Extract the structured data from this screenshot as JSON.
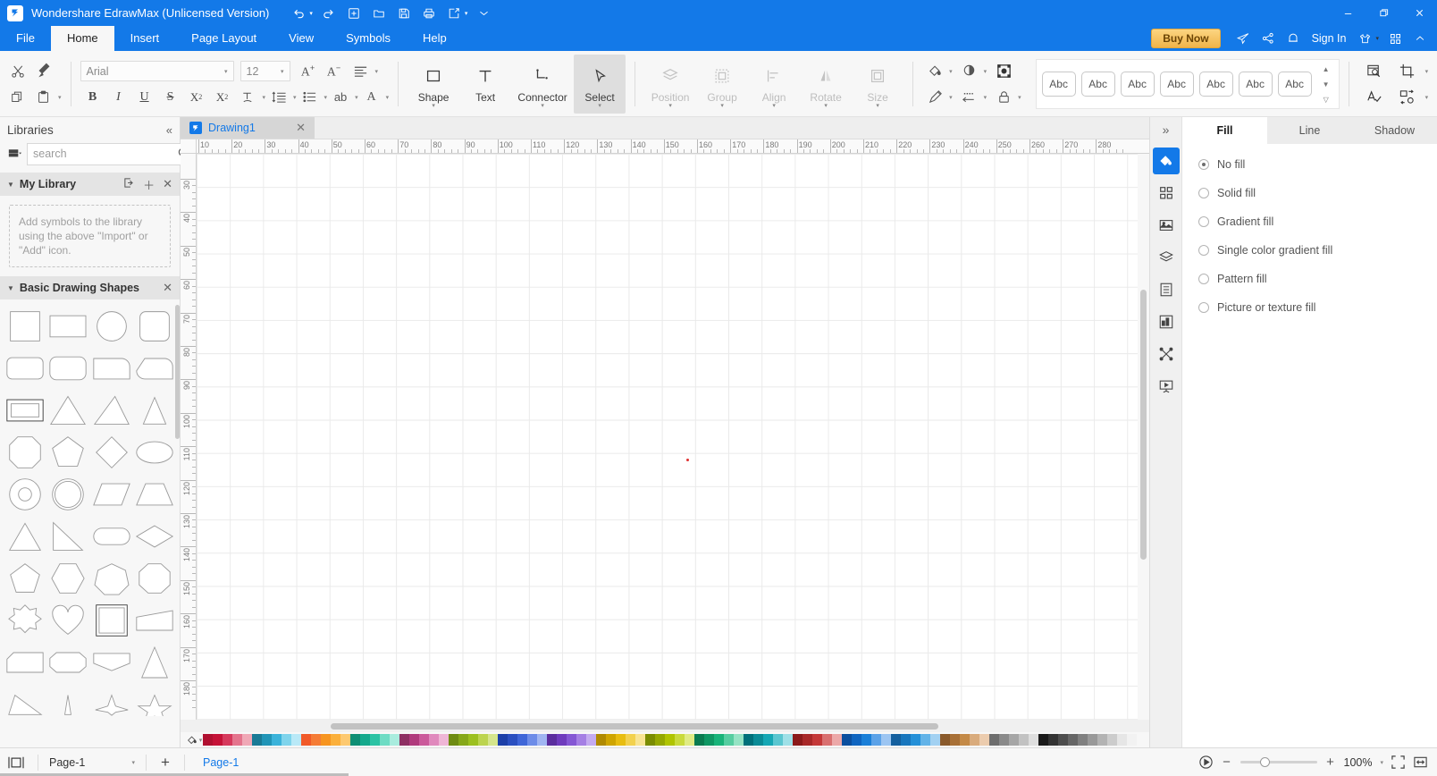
{
  "window": {
    "app_title": "Wondershare EdrawMax (Unlicensed Version)",
    "logo_glyph": "Ɔ",
    "quick_access": [
      {
        "name": "undo-button",
        "glyph": "↺",
        "caret": true
      },
      {
        "name": "redo-button",
        "glyph": "↻",
        "caret": false
      },
      {
        "name": "new-document-button",
        "glyph": "⊞",
        "caret": false
      },
      {
        "name": "open-file-button",
        "glyph": "🗀",
        "caret": false
      },
      {
        "name": "save-button",
        "glyph": "🖫",
        "caret": false
      },
      {
        "name": "print-button",
        "glyph": "🖶",
        "caret": false
      },
      {
        "name": "export-share-button",
        "glyph": "↗",
        "caret": true
      }
    ],
    "more_qat_glyph": "⌄",
    "minimize_label": "—",
    "maximize_label": "❐",
    "close_label": "✕"
  },
  "menubar": {
    "items": [
      {
        "label": "File",
        "active": false
      },
      {
        "label": "Home",
        "active": true
      },
      {
        "label": "Insert",
        "active": false
      },
      {
        "label": "Page Layout",
        "active": false
      },
      {
        "label": "View",
        "active": false
      },
      {
        "label": "Symbols",
        "active": false
      },
      {
        "label": "Help",
        "active": false
      }
    ],
    "buy_now_label": "Buy Now",
    "sign_in_label": "Sign In",
    "right_icons": [
      {
        "name": "send-feedback-icon",
        "glyph": "➤"
      },
      {
        "name": "share-icon",
        "glyph": "⤳"
      },
      {
        "name": "notifications-bell-icon",
        "glyph": "🔔"
      },
      {
        "name": "theme-shirt-icon",
        "glyph": "👕"
      },
      {
        "name": "apps-grid-icon",
        "glyph": "⠿"
      },
      {
        "name": "collapse-ribbon-icon",
        "glyph": "⌃"
      }
    ]
  },
  "ribbon": {
    "clipboard": [
      {
        "name": "cut-button",
        "glyph": "✂",
        "caret": false
      },
      {
        "name": "format-painter-button",
        "glyph": "🖌",
        "caret": false
      },
      {
        "name": "copy-button",
        "glyph": "⧉",
        "caret": false
      },
      {
        "name": "paste-button",
        "glyph": "📋",
        "caret": true
      }
    ],
    "font": {
      "family_value": "Arial",
      "size_value": "12",
      "increase_size_label": "A",
      "decrease_size_label": "A",
      "align_icon": "☰",
      "bold_label": "B",
      "italic_label": "I",
      "underline_label": "U",
      "strikethrough_label": "S",
      "superscript_label": "X²",
      "subscript_label": "X₂",
      "text_color_label": "T",
      "line_spacing_label": "↕☰",
      "bullets_label": "☰",
      "wrap_text_label": "ab",
      "font_style_label": "A"
    },
    "tools": [
      {
        "name": "shape-tool",
        "label": "Shape",
        "icon": "square",
        "enabled": true,
        "active": false,
        "caret": true
      },
      {
        "name": "text-tool",
        "label": "Text",
        "icon": "text",
        "enabled": true,
        "active": false,
        "caret": false
      },
      {
        "name": "connector-tool",
        "label": "Connector",
        "icon": "connector",
        "enabled": true,
        "active": false,
        "caret": true
      },
      {
        "name": "select-tool",
        "label": "Select",
        "icon": "cursor",
        "enabled": true,
        "active": true,
        "caret": true
      }
    ],
    "arrange": [
      {
        "name": "position-tool",
        "label": "Position",
        "icon": "layers",
        "enabled": false,
        "caret": true
      },
      {
        "name": "group-tool",
        "label": "Group",
        "icon": "group",
        "enabled": false,
        "caret": true
      },
      {
        "name": "align-tool",
        "label": "Align",
        "icon": "align",
        "enabled": false,
        "caret": true
      },
      {
        "name": "rotate-tool",
        "label": "Rotate",
        "icon": "rotate",
        "enabled": false,
        "caret": true
      },
      {
        "name": "size-tool",
        "label": "Size",
        "icon": "size",
        "enabled": false,
        "caret": true
      }
    ],
    "style_icons": [
      {
        "name": "fill-color-button",
        "glyph": "fill",
        "caret": true
      },
      {
        "name": "shadow-button",
        "glyph": "shadow",
        "caret": true
      },
      {
        "name": "select-all-button",
        "glyph": "selectall",
        "caret": false
      },
      {
        "name": "line-color-button",
        "glyph": "pen",
        "caret": true
      },
      {
        "name": "line-style-button",
        "glyph": "dash-arrow",
        "caret": true
      },
      {
        "name": "lock-button",
        "glyph": "lock",
        "caret": true
      }
    ],
    "quick_styles_label": "Abc",
    "quick_styles_count": 7,
    "right_tools": [
      {
        "name": "find-replace-button",
        "glyph": "find",
        "caret": false
      },
      {
        "name": "crop-button",
        "glyph": "crop",
        "caret": true
      },
      {
        "name": "spell-check-button",
        "glyph": "spell",
        "caret": false
      },
      {
        "name": "replace-shape-button",
        "glyph": "replace",
        "caret": true
      }
    ]
  },
  "libraries": {
    "title": "Libraries",
    "collapse_glyph": "«",
    "search_placeholder": "search",
    "search_value": "",
    "library_menu_glyph": "🗄",
    "nav_up_glyph": "⌃",
    "nav_down_glyph": "⌄",
    "sections": [
      {
        "name": "My Library",
        "expanded": true,
        "actions": [
          "import-icon",
          "add-icon",
          "close-icon"
        ],
        "empty_text": "Add symbols to the library using the above \"Import\" or \"Add\" icon."
      },
      {
        "name": "Basic Drawing Shapes",
        "expanded": true,
        "actions": [
          "close-icon"
        ]
      }
    ],
    "shapes": [
      "square",
      "rectangle",
      "circle",
      "rounded-square",
      "rounded-rectangle-small",
      "rounded-rectangle",
      "one-corner-rounded-rect",
      "two-corner-rounded-rect",
      "double-rectangle",
      "triangle-isosceles",
      "triangle-right-lean",
      "triangle-narrow",
      "octagon-cut-square",
      "pentagon",
      "diamond",
      "ellipse",
      "donut",
      "concentric-circle",
      "parallelogram",
      "trapezoid",
      "triangle-equilateral",
      "right-triangle",
      "stadium",
      "rhombus",
      "pentagon-2",
      "hexagon",
      "heptagon",
      "octagon",
      "star-8-burst",
      "heart",
      "double-square",
      "tapered-rectangle",
      "chamfer-rectangle",
      "rounded-octagon-rect",
      "notched-rectangle",
      "tall-triangle",
      "scalene-triangle",
      "thin-spike",
      "four-point-star",
      "five-point-star"
    ]
  },
  "canvas": {
    "document_tab": {
      "name": "Drawing1",
      "icon_glyph": "Ɔ",
      "close_glyph": "✕"
    },
    "h_ruler_labels": [
      10,
      20,
      30,
      40,
      50,
      60,
      70,
      80,
      90,
      100,
      110,
      120,
      130,
      140,
      150,
      160,
      170,
      180,
      190,
      200,
      210,
      220,
      230,
      240,
      250,
      260,
      270,
      280
    ],
    "v_ruler_labels": [
      30,
      40,
      50,
      60,
      70,
      80,
      90,
      100,
      110,
      120,
      130,
      140,
      150,
      160,
      170,
      180
    ],
    "palette_icon": "fill-bucket-icon",
    "swatches": [
      "#b01030",
      "#c51237",
      "#d6395c",
      "#e4748d",
      "#f0a8b6",
      "#1a7a96",
      "#2195b7",
      "#3bb3da",
      "#7fd4ec",
      "#b9e9f7",
      "#f15a29",
      "#f57c36",
      "#f79520",
      "#fbb03b",
      "#fdc970",
      "#0d8f74",
      "#14a98c",
      "#2bc3a4",
      "#6edcc4",
      "#a9ecde",
      "#8e2f63",
      "#b03a7d",
      "#cb5a9b",
      "#e089bd",
      "#efb6d6",
      "#6e8c12",
      "#86a819",
      "#9cc01f",
      "#bcd44f",
      "#d5e58c",
      "#1c3fa8",
      "#2a4fc0",
      "#3f66d8",
      "#6d8ce8",
      "#a0b5f2",
      "#5b2d9e",
      "#6f3bbd",
      "#8557d4",
      "#a57fe4",
      "#c4abf0",
      "#b08a00",
      "#cfa500",
      "#e8bd10",
      "#f2d14e",
      "#f8e493",
      "#7a8c00",
      "#95a800",
      "#b0c400",
      "#c9da3c",
      "#e0eb84",
      "#0a7b4f",
      "#0f9763",
      "#18b379",
      "#55cda0",
      "#95e3c4",
      "#00707a",
      "#0a8b96",
      "#15a7b4",
      "#5ac6d0",
      "#9ee0e7",
      "#8b1a1a",
      "#a82828",
      "#c43838",
      "#d97070",
      "#eca8a8",
      "#0b4f9e",
      "#0f65c0",
      "#1a7fd8",
      "#5ba2e8",
      "#9cc5f2",
      "#135f9e",
      "#1876bd",
      "#2490d8",
      "#62b3e8",
      "#a2d1f2",
      "#8a5a2b",
      "#a87036",
      "#c48a47",
      "#d9ab7c",
      "#ecccae",
      "#6e6e6e",
      "#8a8a8a",
      "#a6a6a6",
      "#c2c2c2",
      "#dedede",
      "#1a1a1a",
      "#333333",
      "#4d4d4d",
      "#666666",
      "#808080",
      "#999999",
      "#b3b3b3",
      "#cccccc",
      "#e6e6e6",
      "#f2f2f2"
    ],
    "zoom_percent": "100%"
  },
  "format_panel": {
    "tabs": [
      {
        "label": "Fill",
        "active": true
      },
      {
        "label": "Line",
        "active": false
      },
      {
        "label": "Shadow",
        "active": false
      }
    ],
    "fill_options": [
      {
        "label": "No fill",
        "selected": true
      },
      {
        "label": "Solid fill",
        "selected": false
      },
      {
        "label": "Gradient fill",
        "selected": false
      },
      {
        "label": "Single color gradient fill",
        "selected": false
      },
      {
        "label": "Pattern fill",
        "selected": false
      },
      {
        "label": "Picture or texture fill",
        "selected": false
      }
    ],
    "expand_glyph": "»",
    "dock_items": [
      {
        "name": "dock-fill-style",
        "icon": "paint-bucket-icon",
        "active": true
      },
      {
        "name": "dock-theme",
        "icon": "grid-squares-icon",
        "active": false
      },
      {
        "name": "dock-image",
        "icon": "picture-icon",
        "active": false
      },
      {
        "name": "dock-layers",
        "icon": "layers-icon",
        "active": false
      },
      {
        "name": "dock-page-setup",
        "icon": "document-list-icon",
        "active": false
      },
      {
        "name": "dock-chart",
        "icon": "chart-icon",
        "active": false
      },
      {
        "name": "dock-connections",
        "icon": "nodes-icon",
        "active": false
      },
      {
        "name": "dock-presentation",
        "icon": "presentation-icon",
        "active": false
      }
    ]
  },
  "statusbar": {
    "view_mode_icon": "page-view-icon",
    "page_selector_value": "Page-1",
    "add_page_glyph": "+",
    "active_page_label": "Page-1",
    "zoom": {
      "play_icon": "presentation-play-icon",
      "minus": "−",
      "plus": "+",
      "value": "100%",
      "fit_page_icon": "fit-page-icon",
      "fit_width_icon": "fit-width-icon"
    }
  }
}
